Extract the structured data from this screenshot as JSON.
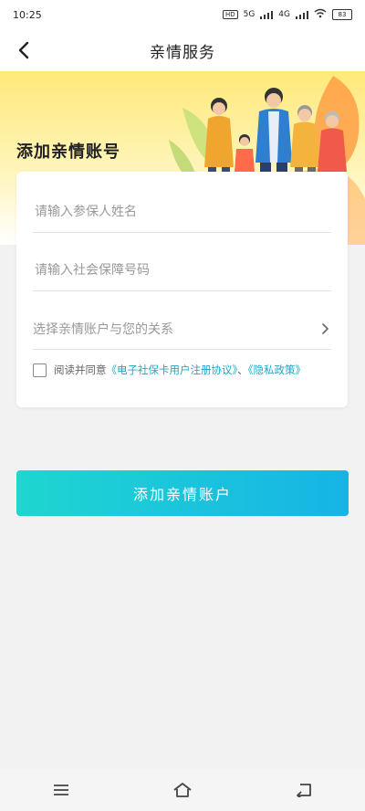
{
  "status_bar": {
    "time": "10:25",
    "network": "5G",
    "network2": "4G",
    "battery": "83"
  },
  "nav": {
    "title": "亲情服务"
  },
  "banner": {
    "title": "添加亲情账号"
  },
  "form": {
    "name_placeholder": "请输入参保人姓名",
    "ssn_placeholder": "请输入社会保障号码",
    "relation_placeholder": "选择亲情账户与您的关系",
    "agree_prefix": "阅读并同意",
    "agreement_link": "《电子社保卡用户注册协议》",
    "separator": "、",
    "privacy_link": "《隐私政策》"
  },
  "submit": {
    "label": "添加亲情账户"
  },
  "colors": {
    "accent_start": "#1fd6d0",
    "accent_end": "#16b4e6",
    "link": "#1aa8c9",
    "banner_yellow": "#ffe97a"
  }
}
